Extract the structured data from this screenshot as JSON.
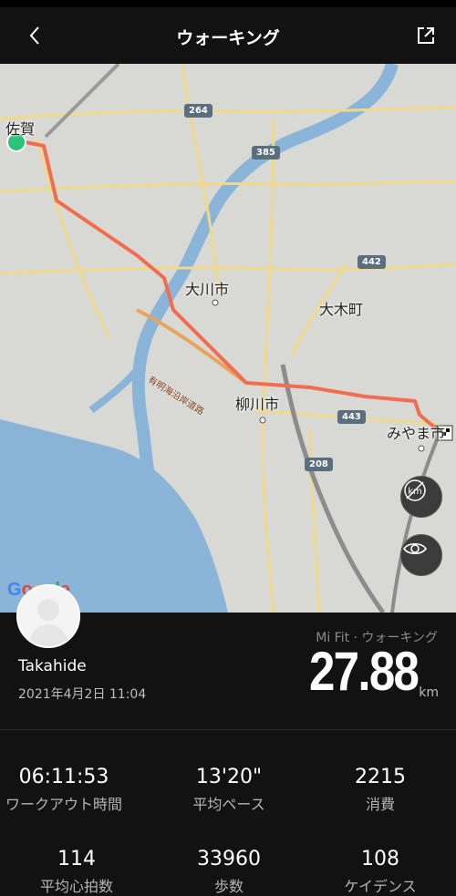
{
  "header": {
    "title": "ウォーキング",
    "back_icon": "chevron-left-icon",
    "share_icon": "share-icon"
  },
  "map": {
    "places": {
      "saga": "佐賀",
      "okawa": "大川市",
      "oki": "大木町",
      "yanagawa": "柳川市",
      "miyama": "みやま市"
    },
    "roads": {
      "r264": "264",
      "r385": "385",
      "r442": "442",
      "r443": "443",
      "r208": "208"
    },
    "road_name": "有明海沿岸道路",
    "google": "Google",
    "buttons": {
      "km": "km",
      "view": "eye-icon"
    },
    "route_color": "#f26c4f",
    "start_color": "#2bc27a"
  },
  "workout": {
    "username": "Takahide",
    "datetime": "2021年4月2日 11:04",
    "source": "Mi Fit · ウォーキング",
    "distance": "27.88",
    "unit": "km"
  },
  "stats": [
    {
      "value": "06:11:53",
      "label": "ワークアウト時間"
    },
    {
      "value": "13'20\"",
      "label": "平均ペース"
    },
    {
      "value": "2215",
      "label": "消費"
    },
    {
      "value": "114",
      "label": "平均心拍数"
    },
    {
      "value": "33960",
      "label": "歩数"
    },
    {
      "value": "108",
      "label": "ケイデンス"
    }
  ]
}
